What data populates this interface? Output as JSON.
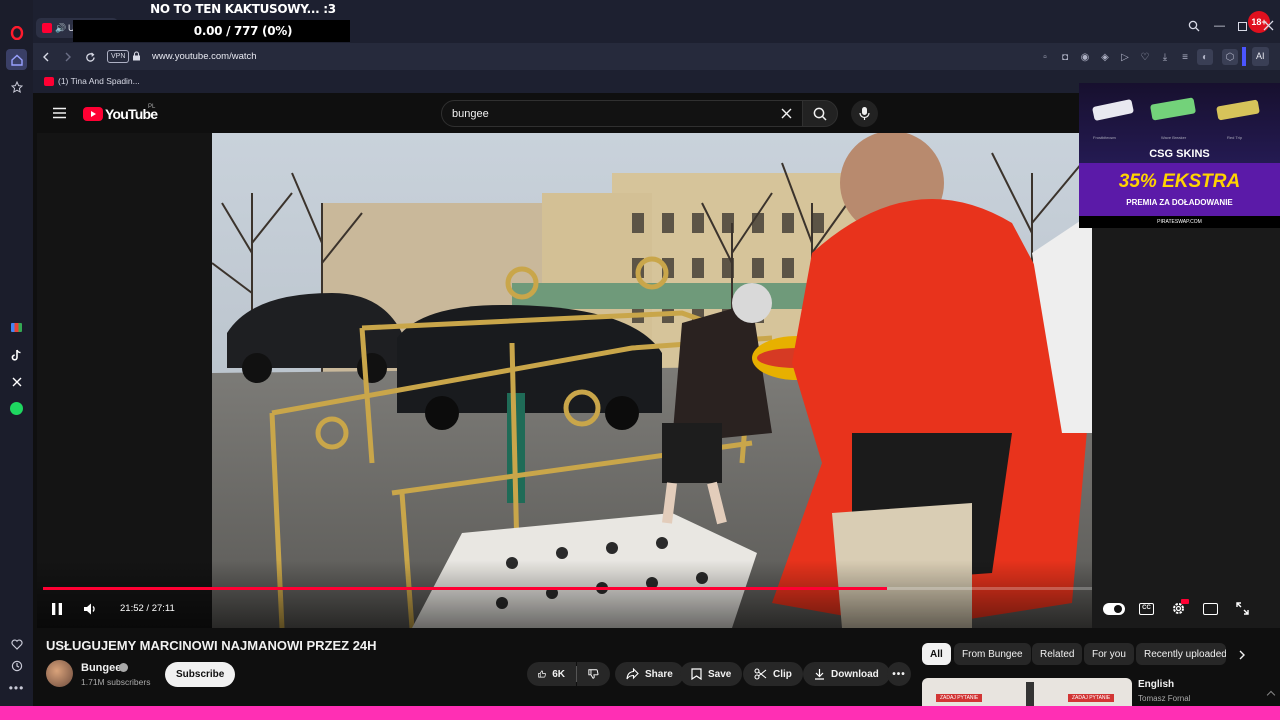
{
  "stream_overlay": {
    "line1": "NO TO TEN KAKTUSOWY... :3",
    "line2": "0.00 / 777 (0%)"
  },
  "browser": {
    "tab_title": "US",
    "url": "www.youtube.com/watch",
    "vpn_label": "VPN",
    "ai_label": "AI",
    "bookmark": "(1) Tina And Spadin...",
    "badge": "18+"
  },
  "youtube": {
    "logo_text": "YouTube",
    "region": "PL",
    "search_value": "bungee",
    "player": {
      "time": "21:52 / 27:11",
      "progress": 0.805
    },
    "video": {
      "title": "USŁUGUJEMY MARCINOWI NAJMANOWI PRZEZ 24H",
      "channel": "Bungee",
      "subscribers": "1.71M subscribers",
      "subscribe_label": "Subscribe",
      "likes": "6K",
      "share_label": "Share",
      "save_label": "Save",
      "clip_label": "Clip",
      "download_label": "Download"
    },
    "chips": [
      "All",
      "From Bungee",
      "Related",
      "For you",
      "Recently uploaded"
    ],
    "related": {
      "thumb_text_1": "ZADAJ PYTANIE",
      "thumb_text_2": "ZADAJ PYTANIE",
      "title": "English",
      "author": "Tomasz Fornal"
    }
  },
  "ad": {
    "brand": "CSG SKINS",
    "headline": "35% EKSTRA",
    "subline": "PREMIA ZA DOŁADOWANIE",
    "site": "PIRATESWAP.COM",
    "weapons": [
      "Frostbiteown",
      "Wave Breaker",
      "Red Trip"
    ]
  },
  "colors": {
    "accent_red": "#ff0033",
    "opera_red": "#ff1b2d",
    "ad_purple": "#5b1aa8",
    "ad_yellow": "#ffd400",
    "pink_bar": "#ff2fb4"
  }
}
